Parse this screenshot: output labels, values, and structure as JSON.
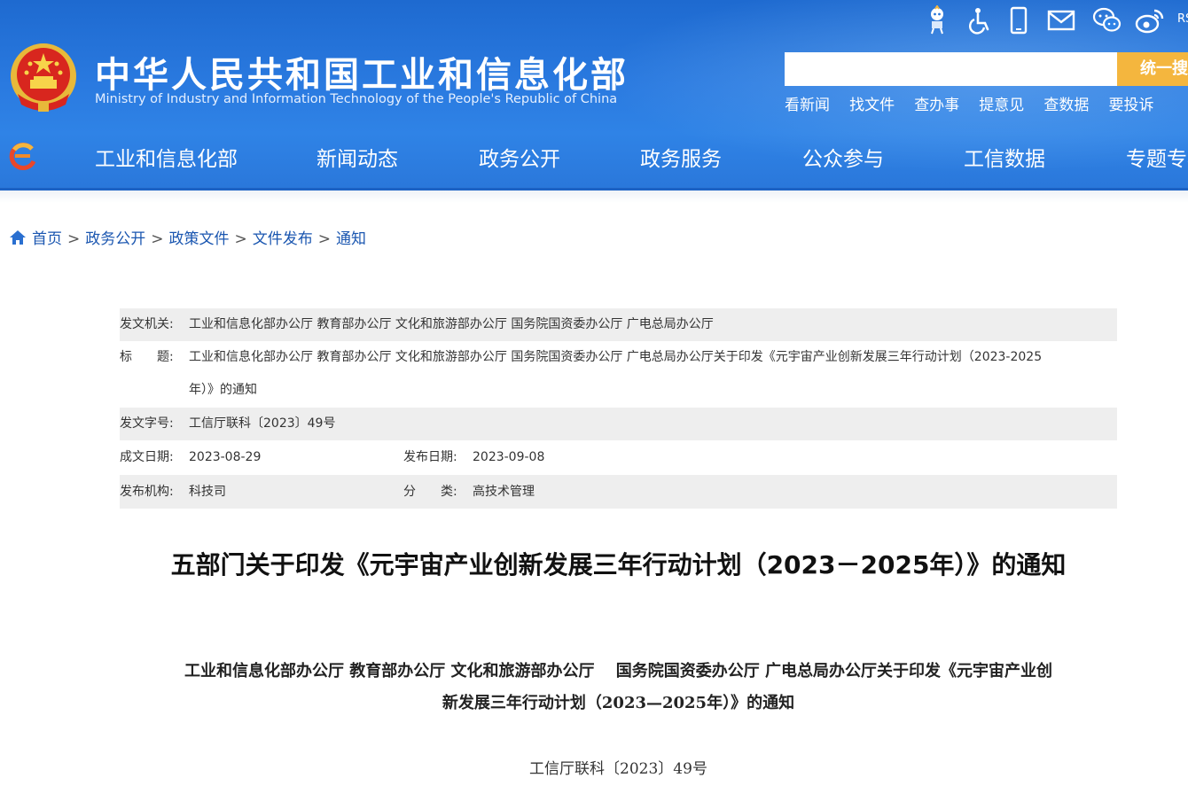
{
  "header": {
    "title": "中华人民共和国工业和信息化部",
    "subtitle": "Ministry of Industry and Information Technology of the People's Republic of China",
    "top_icons": [
      "robot-icon",
      "accessibility-icon",
      "mobile-icon",
      "mail-icon",
      "wechat-icon",
      "weibo-icon"
    ],
    "rss_label": "RS",
    "search": {
      "placeholder": "",
      "button_label": "统一搜"
    },
    "quick_links": [
      "看新闻",
      "找文件",
      "查办事",
      "提意见",
      "查数据",
      "要投诉"
    ],
    "nav": [
      "工业和信息化部",
      "新闻动态",
      "政务公开",
      "政务服务",
      "公众参与",
      "工信数据",
      "专题专栏"
    ]
  },
  "breadcrumb": {
    "items": [
      "首页",
      "政务公开",
      "政策文件",
      "文件发布",
      "通知"
    ],
    "separator": ">"
  },
  "meta": {
    "issuer_label": "发文机关:",
    "issuer": "工业和信息化部办公厅 教育部办公厅 文化和旅游部办公厅 国务院国资委办公厅 广电总局办公厅",
    "title_label": "标　　题:",
    "title_line1": "工业和信息化部办公厅 教育部办公厅 文化和旅游部办公厅 国务院国资委办公厅 广电总局办公厅关于印发《元宇宙产业创新发展三年行动计划（2023-2025",
    "title_line2": "年）》的通知",
    "docno_label": "发文字号:",
    "docno": "工信厅联科〔2023〕49号",
    "written_label": "成文日期:",
    "written_date": "2023-08-29",
    "published_label": "发布日期:",
    "published_date": "2023-09-08",
    "org_label": "发布机构:",
    "org": "科技司",
    "category_label": "分　　类:",
    "category": "高技术管理"
  },
  "document": {
    "title": "五部门关于印发《元宇宙产业创新发展三年行动计划（2023－2025年）》的通知",
    "subtitle_line1": "工业和信息化部办公厅 教育部办公厅 文化和旅游部办公厅　 国务院国资委办公厅 广电总局办公厅关于印发《元宇宙产业创",
    "subtitle_line2": "新发展三年行动计划（2023—2025年）》的通知",
    "doc_number": "工信厅联科〔2023〕49号"
  }
}
